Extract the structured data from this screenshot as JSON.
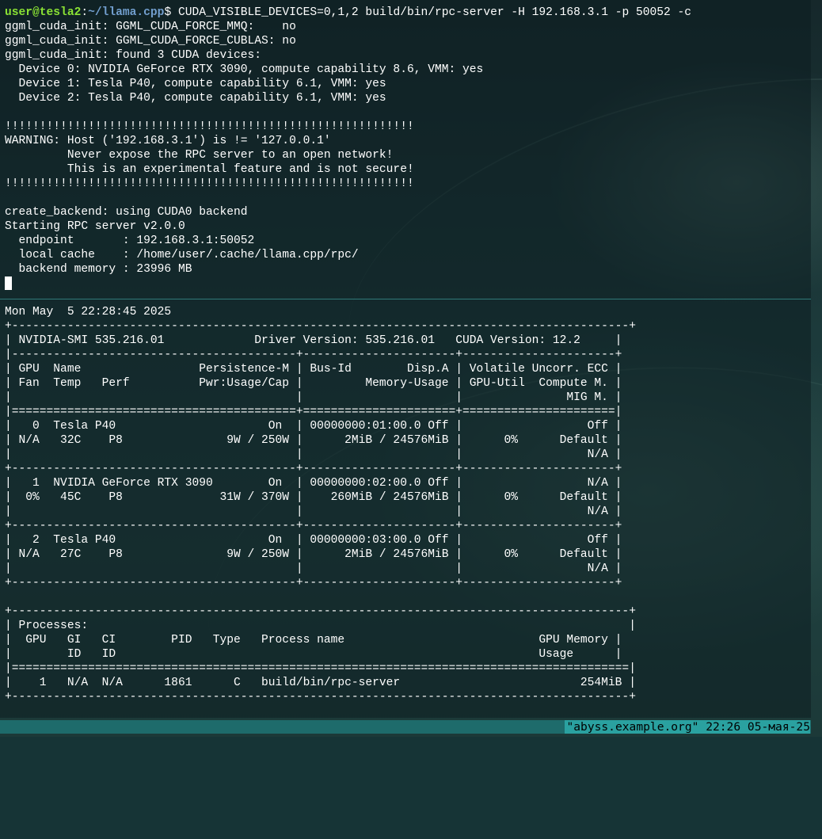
{
  "prompt": {
    "user_host": "user@tesla2",
    "separator": ":",
    "cwd": "~/llama.cpp",
    "symbol": "$",
    "command": " CUDA_VISIBLE_DEVICES=0,1,2 build/bin/rpc-server -H 192.168.3.1 -p 50052 -c"
  },
  "top_output": [
    "ggml_cuda_init: GGML_CUDA_FORCE_MMQ:    no",
    "ggml_cuda_init: GGML_CUDA_FORCE_CUBLAS: no",
    "ggml_cuda_init: found 3 CUDA devices:",
    "  Device 0: NVIDIA GeForce RTX 3090, compute capability 8.6, VMM: yes",
    "  Device 1: Tesla P40, compute capability 6.1, VMM: yes",
    "  Device 2: Tesla P40, compute capability 6.1, VMM: yes",
    "",
    "!!!!!!!!!!!!!!!!!!!!!!!!!!!!!!!!!!!!!!!!!!!!!!!!!!!!!!!!!!!",
    "WARNING: Host ('192.168.3.1') is != '127.0.0.1'",
    "         Never expose the RPC server to an open network!",
    "         This is an experimental feature and is not secure!",
    "!!!!!!!!!!!!!!!!!!!!!!!!!!!!!!!!!!!!!!!!!!!!!!!!!!!!!!!!!!!",
    "",
    "create_backend: using CUDA0 backend",
    "Starting RPC server v2.0.0",
    "  endpoint       : 192.168.3.1:50052",
    "  local cache    : /home/user/.cache/llama.cpp/rpc/",
    "  backend memory : 23996 MB"
  ],
  "bottom_output": [
    "Mon May  5 22:28:45 2025",
    "+-----------------------------------------------------------------------------------------+",
    "| NVIDIA-SMI 535.216.01             Driver Version: 535.216.01   CUDA Version: 12.2     |",
    "|-----------------------------------------+----------------------+----------------------+",
    "| GPU  Name                 Persistence-M | Bus-Id        Disp.A | Volatile Uncorr. ECC |",
    "| Fan  Temp   Perf          Pwr:Usage/Cap |         Memory-Usage | GPU-Util  Compute M. |",
    "|                                         |                      |               MIG M. |",
    "|=========================================+======================+======================|",
    "|   0  Tesla P40                      On  | 00000000:01:00.0 Off |                  Off |",
    "| N/A   32C    P8               9W / 250W |      2MiB / 24576MiB |      0%      Default |",
    "|                                         |                      |                  N/A |",
    "+-----------------------------------------+----------------------+----------------------+",
    "|   1  NVIDIA GeForce RTX 3090        On  | 00000000:02:00.0 Off |                  N/A |",
    "|  0%   45C    P8              31W / 370W |    260MiB / 24576MiB |      0%      Default |",
    "|                                         |                      |                  N/A |",
    "+-----------------------------------------+----------------------+----------------------+",
    "|   2  Tesla P40                      On  | 00000000:03:00.0 Off |                  Off |",
    "| N/A   27C    P8               9W / 250W |      2MiB / 24576MiB |      0%      Default |",
    "|                                         |                      |                  N/A |",
    "+-----------------------------------------+----------------------+----------------------+",
    "",
    "+-----------------------------------------------------------------------------------------+",
    "| Processes:                                                                              |",
    "|  GPU   GI   CI        PID   Type   Process name                            GPU Memory |",
    "|        ID   ID                                                             Usage      |",
    "|=========================================================================================|",
    "|    1   N/A  N/A      1861      C   build/bin/rpc-server                          254MiB |",
    "+-----------------------------------------------------------------------------------------+"
  ],
  "status_bar": {
    "right": "\"abyss.example.org\" 22:26 05-мая-25"
  }
}
